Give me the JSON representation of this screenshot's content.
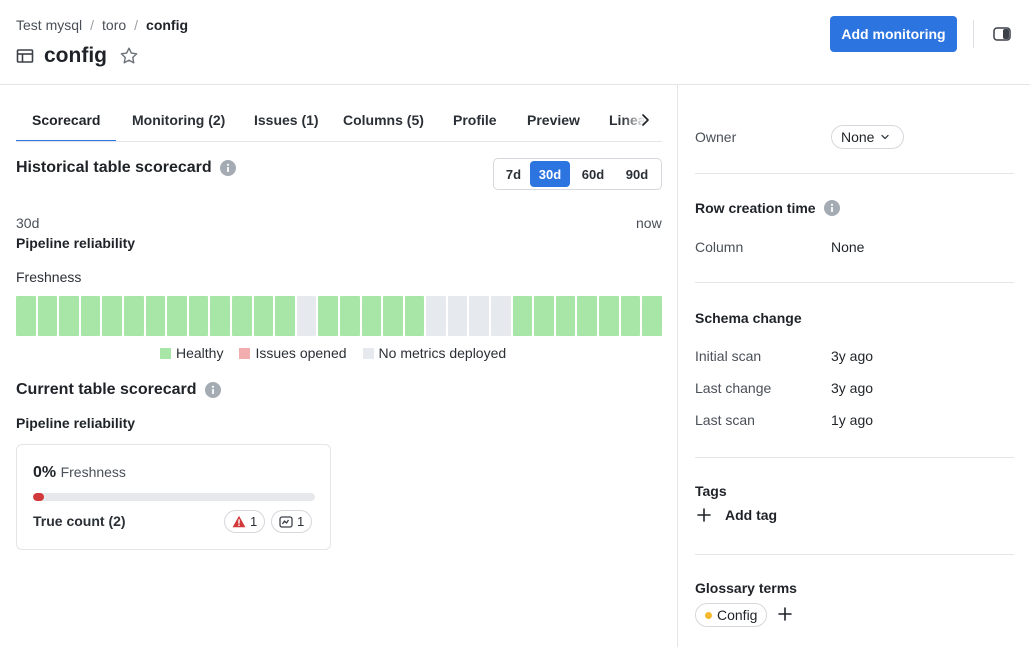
{
  "breadcrumb": [
    "Test mysql",
    "toro",
    "config"
  ],
  "breadcrumb_sep": "/",
  "page_title": "config",
  "header": {
    "add_button": "Add monitoring"
  },
  "tabs": [
    "Scorecard",
    "Monitoring (2)",
    "Issues (1)",
    "Columns (5)",
    "Profile",
    "Preview",
    "Lineage"
  ],
  "active_tab": "Scorecard",
  "historical": {
    "title": "Historical table scorecard",
    "ranges": [
      "7d",
      "30d",
      "60d",
      "90d"
    ],
    "selected_range": "30d",
    "start_label": "30d",
    "end_label": "now",
    "subtitle": "Pipeline reliability",
    "metric_label": "Freshness",
    "days": [
      "healthy",
      "healthy",
      "healthy",
      "healthy",
      "healthy",
      "healthy",
      "healthy",
      "healthy",
      "healthy",
      "healthy",
      "healthy",
      "healthy",
      "healthy",
      "none",
      "healthy",
      "healthy",
      "healthy",
      "healthy",
      "healthy",
      "none",
      "none",
      "none",
      "none",
      "healthy",
      "healthy",
      "healthy",
      "healthy",
      "healthy",
      "healthy",
      "healthy"
    ],
    "legend": [
      {
        "key": "healthy",
        "label": "Healthy",
        "color": "#a8e6a8"
      },
      {
        "key": "issues",
        "label": "Issues opened",
        "color": "#f2aeae"
      },
      {
        "key": "none",
        "label": "No metrics deployed",
        "color": "#e6e9ee"
      }
    ]
  },
  "current": {
    "title": "Current table scorecard",
    "subtitle": "Pipeline reliability",
    "card": {
      "percent": "0%",
      "metric": "Freshness",
      "progress_fraction": 0.04,
      "count_label": "True count (2)",
      "alerts": "1",
      "monitors": "1"
    }
  },
  "sidebar": {
    "owner_label": "Owner",
    "owner_value": "None",
    "row_creation_title": "Row creation time",
    "column_label": "Column",
    "column_value": "None",
    "schema_title": "Schema change",
    "schema_rows": [
      {
        "label": "Initial scan",
        "value": "3y ago"
      },
      {
        "label": "Last change",
        "value": "3y ago"
      },
      {
        "label": "Last scan",
        "value": "1y ago"
      }
    ],
    "tags_title": "Tags",
    "add_tag": "Add tag",
    "glossary_title": "Glossary terms",
    "glossary_term": "Config",
    "glossary_dot_color": "#f5b82e"
  },
  "colors": {
    "accent": "#2c74e0",
    "danger": "#d1393a"
  }
}
